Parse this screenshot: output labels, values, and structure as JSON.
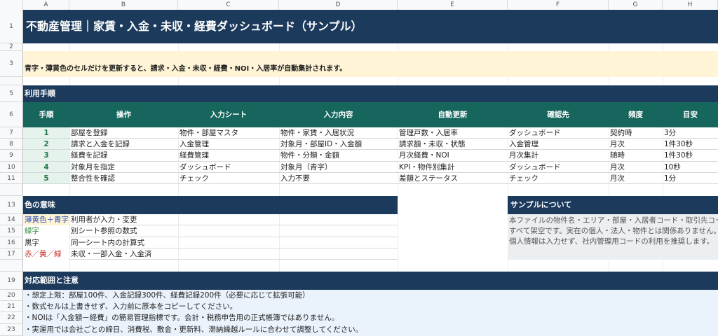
{
  "columns": [
    "A",
    "B",
    "C",
    "D",
    "E",
    "F",
    "G",
    "H"
  ],
  "rows": [
    "1",
    "2",
    "3",
    "5",
    "6",
    "7",
    "8",
    "9",
    "10",
    "11",
    "13",
    "14",
    "15",
    "16",
    "17",
    "19",
    "20",
    "21",
    "22",
    "23"
  ],
  "title": "不動産管理｜家賃・入金・未収・経費ダッシュボード（サンプル）",
  "notice": "青字・薄黄色のセルだけを更新すると、請求・入金・未収・経費・NOI・入居率が自動集計されます。",
  "usage": {
    "header": "利用手順",
    "columns": [
      "手順",
      "操作",
      "入力シート",
      "入力内容",
      "自動更新",
      "確認先",
      "頻度",
      "目安"
    ],
    "rows": [
      [
        "1",
        "部屋を登録",
        "物件・部屋マスタ",
        "物件・家賃・入居状況",
        "管理戸数・入居率",
        "ダッシュボード",
        "契約時",
        "3分"
      ],
      [
        "2",
        "請求と入金を記録",
        "入金管理",
        "対象月・部屋ID・入金額",
        "請求額・未収・状態",
        "入金管理",
        "月次",
        "1件30秒"
      ],
      [
        "3",
        "経費を記録",
        "経費管理",
        "物件・分類・金額",
        "月次経費・NOI",
        "月次集計",
        "随時",
        "1件30秒"
      ],
      [
        "4",
        "対象月を指定",
        "ダッシュボード",
        "対象月（青字）",
        "KPI・物件別集計",
        "ダッシュボード",
        "月次",
        "10秒"
      ],
      [
        "5",
        "整合性を確認",
        "チェック",
        "入力不要",
        "差額とステータス",
        "チェック",
        "月次",
        "1分"
      ]
    ]
  },
  "colors": {
    "header": "色の意味",
    "rows": [
      {
        "label": "薄黄色＋青字",
        "desc": "利用者が入力・変更"
      },
      {
        "label": "緑字",
        "desc": "別シート参照の数式"
      },
      {
        "label": "黒字",
        "desc": "同一シート内の計算式"
      },
      {
        "label": "赤／黄／緑",
        "desc": "未収・一部入金・入金済"
      }
    ]
  },
  "sample": {
    "header": "サンプルについて",
    "lines": [
      "本ファイルの物件名・エリア・部屋・入居者コード・取引先コードは",
      "すべて架空です。実在の個人・法人・物件とは関係ありません。",
      "個人情報は入力せず、社内管理用コードの利用を推奨します。"
    ]
  },
  "scope": {
    "header": "対応範囲と注意",
    "lines": [
      "・想定上限：部屋100件、入金記録300件、経費記録200件（必要に応じて拡張可能）",
      "・数式セルは上書きせず、入力前に原本をコピーしてください。",
      "・NOIは「入金額－経費」の簡易管理指標です。会計・税務申告用の正式帳簿ではありません。",
      "・実運用では会社ごとの締日、消費税、敷金・更新料、滞納繰越ルールに合わせて調整してください。"
    ]
  },
  "palette": {
    "title_bg": "#1b3a5c",
    "teal": "#17665e",
    "notice_bg": "#fff4d6",
    "input_bg": "#e6f3ec",
    "note_bg": "#eaf2fb",
    "blue_text": "#2a4db3",
    "green_text": "#2e8a3a",
    "red_text": "#c62828"
  }
}
